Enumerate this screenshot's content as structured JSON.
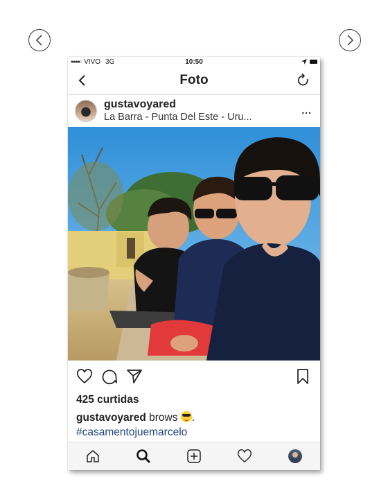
{
  "carousel": {
    "prev_icon": "chevron-left-circle-icon",
    "next_icon": "chevron-right-circle-icon"
  },
  "status_bar": {
    "carrier": "VIVO",
    "network": "3G",
    "time": "10:50",
    "signal_dots": "●●●●○",
    "location_icon": "location-arrow-icon",
    "battery_icon": "battery-icon"
  },
  "nav": {
    "title": "Foto",
    "back_icon": "chevron-left-icon",
    "refresh_icon": "refresh-icon"
  },
  "post": {
    "username": "gustavoyared",
    "location": "La Barra - Punta Del Este - Uru...",
    "more_label": "...",
    "photo_icon": "selfie-photo"
  },
  "actions": {
    "like_icon": "heart-icon",
    "comment_icon": "comment-icon",
    "share_icon": "send-icon",
    "save_icon": "bookmark-icon"
  },
  "likes": "425 curtidas",
  "caption": {
    "user": "gustavoyared",
    "text": "brows",
    "emoji": "sunglasses-emoji",
    "suffix": ".",
    "hashtag": "#casamentojuemarcelo"
  },
  "tab_bar": {
    "items": [
      "home-icon",
      "search-icon",
      "add-post-icon",
      "activity-heart-icon",
      "profile-avatar"
    ]
  },
  "colors": {
    "hashtag": "#1f3f7a",
    "sky": "#4aa3e0",
    "shorts": "#e23a3a"
  }
}
